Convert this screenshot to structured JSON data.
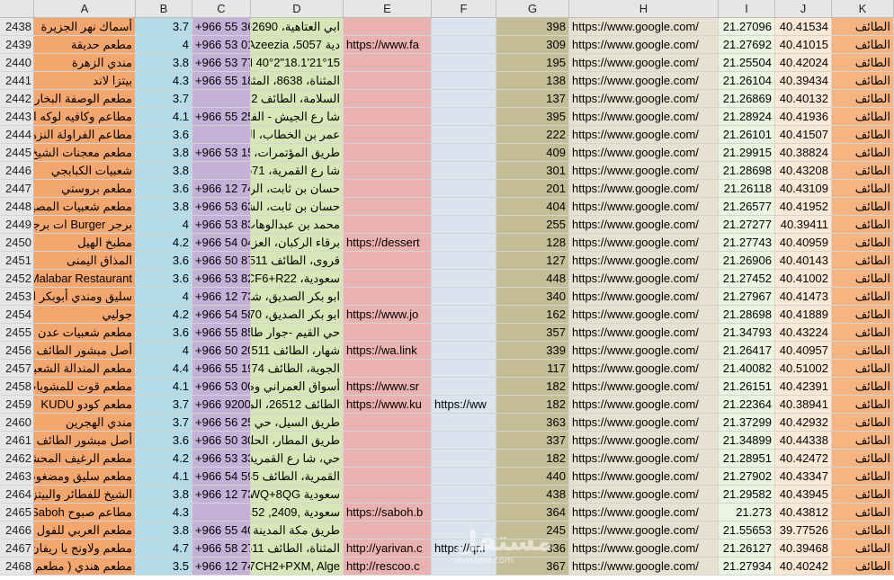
{
  "columns": [
    "A",
    "B",
    "C",
    "D",
    "E",
    "F",
    "G",
    "H",
    "I",
    "J",
    "K"
  ],
  "rows": [
    {
      "n": "2438",
      "A": "أسماك نهر الجزيرة",
      "B": "3.7",
      "C": "+966 55 36",
      "D": "ابي العتاهية، 2690-4",
      "E": "",
      "F": "",
      "G": "398",
      "H": "https://www.google.com/",
      "I": "21.27096",
      "J": "40.41534",
      "K": "الطائف"
    },
    {
      "n": "2439",
      "A": "مطعم حديقة",
      "B": "4",
      "C": "+966 53 01",
      "D": "دية Azeezia ،5057",
      "E": "https://www.fa",
      "F": "",
      "G": "309",
      "H": "https://www.google.com/",
      "I": "21.27692",
      "J": "40.41015",
      "K": "الطائف"
    },
    {
      "n": "2440",
      "A": "مندي الزهرة",
      "B": "3.8",
      "C": "+966 53 77",
      "D": "21°15'18.1\"N 40°2",
      "E": "",
      "F": "",
      "G": "195",
      "H": "https://www.google.com/",
      "I": "21.25504",
      "J": "40.42024",
      "K": "الطائف"
    },
    {
      "n": "2441",
      "A": "بيتزا لاند",
      "B": "4.3",
      "C": "+966 55 18",
      "D": "المثناة، 8638، المثناة",
      "E": "",
      "F": "",
      "G": "138",
      "H": "https://www.google.com/",
      "I": "21.26104",
      "J": "40.39434",
      "K": "الطائف"
    },
    {
      "n": "2442",
      "A": "مطعم الوصفة البخارية",
      "B": "3.7",
      "C": "",
      "D": "السلامة، الطائف 522",
      "E": "",
      "F": "",
      "G": "137",
      "H": "https://www.google.com/",
      "I": "21.26869",
      "J": "40.40132",
      "K": "الطائف"
    },
    {
      "n": "2443",
      "A": "مطاعم وكافيه لوكه ابق",
      "B": "4.1",
      "C": "+966 55 25",
      "D": "شا رع الجيش - الفيص",
      "E": "",
      "F": "",
      "G": "395",
      "H": "https://www.google.com/",
      "I": "21.28924",
      "J": "40.41936",
      "K": "الطائف"
    },
    {
      "n": "2444",
      "A": "مطاعم الفراولة النزهة",
      "B": "3.6",
      "C": "",
      "D": "عمر بن الخطاب، الش",
      "E": "",
      "F": "",
      "G": "222",
      "H": "https://www.google.com/",
      "I": "21.26101",
      "J": "40.41507",
      "K": "الطائف"
    },
    {
      "n": "2445",
      "A": "مطعم معجنات الشيخ",
      "B": "3.8",
      "C": "+966 53 15",
      "D": "طريق المؤتمرات، الخ",
      "E": "",
      "F": "",
      "G": "409",
      "H": "https://www.google.com/",
      "I": "21.29915",
      "J": "40.38824",
      "K": "الطائف"
    },
    {
      "n": "2446",
      "A": "شعبيات الكبابجي",
      "B": "3.8",
      "C": "",
      "D": "شا رع القمرية، 7571",
      "E": "",
      "F": "",
      "G": "301",
      "H": "https://www.google.com/",
      "I": "21.28698",
      "J": "40.43208",
      "K": "الطائف"
    },
    {
      "n": "2447",
      "A": "مطعم بروستي",
      "B": "3.6",
      "C": "+966 12 74",
      "D": "حسان بن ثابت، الربي",
      "E": "",
      "F": "",
      "G": "201",
      "H": "https://www.google.com/",
      "I": "21.26118",
      "J": "40.43109",
      "K": "الطائف"
    },
    {
      "n": "2448",
      "A": "مطعم شعبيات المصيف",
      "B": "3.8",
      "C": "+966 53 63",
      "D": "حسان بن ثابت، الشه",
      "E": "",
      "F": "",
      "G": "404",
      "H": "https://www.google.com/",
      "I": "21.26577",
      "J": "40.41952",
      "K": "الطائف"
    },
    {
      "n": "2449",
      "A": "برجر Burger ات برجر",
      "B": "4",
      "C": "+966 53 83",
      "D": "محمد بن عبدالوهاب",
      "E": "",
      "F": "",
      "G": "255",
      "H": "https://www.google.com/",
      "I": "21.27277",
      "J": "40.39411",
      "K": "الطائف"
    },
    {
      "n": "2450",
      "A": "مطبخ الهيل",
      "B": "4.2",
      "C": "+966 54 04",
      "D": "برقاء الركبان، العزيز",
      "E": "https://dessert",
      "F": "",
      "G": "128",
      "H": "https://www.google.com/",
      "I": "21.27743",
      "J": "40.40959",
      "K": "الطائف"
    },
    {
      "n": "2451",
      "A": "المذاق اليمنى",
      "B": "3.6",
      "C": "+966 50 87",
      "D": "قروى، الطائف 6511",
      "E": "",
      "F": "",
      "G": "127",
      "H": "https://www.google.com/",
      "I": "21.26906",
      "J": "40.40143",
      "K": "الطائف"
    },
    {
      "n": "2452",
      "A": "Malabar Restaurant",
      "B": "3.6",
      "C": "+966 53 82",
      "D": "سعودية، 7CF6+R22",
      "E": "",
      "F": "",
      "G": "448",
      "H": "https://www.google.com/",
      "I": "21.27452",
      "J": "40.41002",
      "K": "الطائف"
    },
    {
      "n": "2453",
      "A": "سليق ومندي أبوبكر الس",
      "B": "4",
      "C": "+966 12 73",
      "D": "ابو بكر الصديق، شبرا",
      "E": "",
      "F": "",
      "G": "340",
      "H": "https://www.google.com/",
      "I": "21.27967",
      "J": "40.41473",
      "K": "الطائف"
    },
    {
      "n": "2454",
      "A": "جوليي",
      "B": "4.2",
      "C": "+966 54 58",
      "D": "ابو بكر الصديق، 8570",
      "E": "https://www.jo",
      "F": "",
      "G": "162",
      "H": "https://www.google.com/",
      "I": "21.28698",
      "J": "40.41889",
      "K": "الطائف"
    },
    {
      "n": "2455",
      "A": "مطعم شعبيات عدن",
      "B": "3.6",
      "C": "+966 55 85",
      "D": "حي القيم -جوار طازه",
      "E": "",
      "F": "",
      "G": "357",
      "H": "https://www.google.com/",
      "I": "21.34793",
      "J": "40.43224",
      "K": "الطائف"
    },
    {
      "n": "2456",
      "A": "أصل مبشور الطائف شا",
      "B": "4",
      "C": "+966 50 20",
      "D": "شهار، الطائف 26511",
      "E": "https://wa.link",
      "F": "",
      "G": "339",
      "H": "https://www.google.com/",
      "I": "21.26417",
      "J": "40.40957",
      "K": "الطائف"
    },
    {
      "n": "2457",
      "A": "مطعم المندالة الشعبي",
      "B": "4.4",
      "C": "+966 55 19",
      "D": "الجوية، الطائف 574",
      "E": "",
      "F": "",
      "G": "117",
      "H": "https://www.google.com/",
      "I": "21.40082",
      "J": "40.51002",
      "K": "الطائف"
    },
    {
      "n": "2458",
      "A": "مطعم قوت للمشويات",
      "B": "4.1",
      "C": "+966 53 00",
      "D": "أسواق العمراني وصرا",
      "E": "https://www.sr",
      "F": "",
      "G": "182",
      "H": "https://www.google.com/",
      "I": "21.26151",
      "J": "40.42391",
      "K": "الطائف"
    },
    {
      "n": "2459",
      "A": "مطعم كودو KUDU",
      "B": "3.7",
      "C": "+966 9200",
      "D": "الطائف 26512، المما",
      "E": "https://www.ku",
      "F": "https://ww",
      "G": "182",
      "H": "https://www.google.com/",
      "I": "21.22364",
      "J": "40.38941",
      "K": "الطائف"
    },
    {
      "n": "2460",
      "A": "مندي الهجرين",
      "B": "3.7",
      "C": "+966 56 25",
      "D": "طريق السيل، حي القي",
      "E": "",
      "F": "",
      "G": "363",
      "H": "https://www.google.com/",
      "I": "21.37299",
      "J": "40.42932",
      "K": "الطائف"
    },
    {
      "n": "2461",
      "A": "أصل مبشور الطائف ط",
      "B": "3.6",
      "C": "+966 50 30",
      "D": "طريق المطار، الحلقة",
      "E": "",
      "F": "",
      "G": "337",
      "H": "https://www.google.com/",
      "I": "21.34899",
      "J": "40.44338",
      "K": "الطائف"
    },
    {
      "n": "2462",
      "A": "مطعم الرغيف المحشي",
      "B": "4.2",
      "C": "+966 53 33",
      "D": "حي، شا رع القمرية، الة",
      "E": "",
      "F": "",
      "G": "182",
      "H": "https://www.google.com/",
      "I": "21.28951",
      "J": "40.42472",
      "K": "الطائف"
    },
    {
      "n": "2463",
      "A": "مطعم سليق ومضغوط",
      "B": "4.1",
      "C": "+966 54 59",
      "D": "القمرية، الطائف 345",
      "E": "",
      "F": "",
      "G": "440",
      "H": "https://www.google.com/",
      "I": "21.27902",
      "J": "40.43347",
      "K": "الطائف"
    },
    {
      "n": "2464",
      "A": "الشيخ للفطائر والبيتزا ا",
      "B": "3.8",
      "C": "+966 12 73",
      "D": "سعودية 7CWQ+8QG",
      "E": "",
      "F": "",
      "G": "438",
      "H": "https://www.google.com/",
      "I": "21.29582",
      "J": "40.43945",
      "K": "الطائف"
    },
    {
      "n": "2465",
      "A": "مطاعم صبوح Saboh",
      "B": "4.3",
      "C": "",
      "D": "سعودية ,2409, 9452",
      "E": "https://saboh.b",
      "F": "",
      "G": "364",
      "H": "https://www.google.com/",
      "I": "21.273",
      "J": "40.43812",
      "K": "الطائف"
    },
    {
      "n": "2466",
      "A": "مطعم العربي للفول الي",
      "B": "3.8",
      "C": "+966 55 40",
      "D": "طريق مكة المدينة الم",
      "E": "",
      "F": "",
      "G": "245",
      "H": "https://www.google.com/",
      "I": "21.55653",
      "J": "39.77526",
      "K": "الطائف"
    },
    {
      "n": "2467",
      "A": "مطعم ولاونج يا ريفان E",
      "B": "4.7",
      "C": "+966 58 27",
      "D": "المثناة، الطائف 6511",
      "E": "http://yarivan.c",
      "F": "https://qr.i",
      "G": "336",
      "H": "https://www.google.com/",
      "I": "21.26127",
      "J": "40.39468",
      "K": "الطائف"
    },
    {
      "n": "2468",
      "A": "مطعم هندي ( مطعم ال",
      "B": "3.5",
      "C": "+966 12 74",
      "D": "7CH2+PXM, Alge",
      "E": "http://rescoo.c",
      "F": "",
      "G": "367",
      "H": "https://www.google.com/",
      "I": "21.27934",
      "J": "40.40242",
      "K": "الطائف"
    }
  ],
  "watermark": "مستقل",
  "watermark_sub": "mostaql.com"
}
